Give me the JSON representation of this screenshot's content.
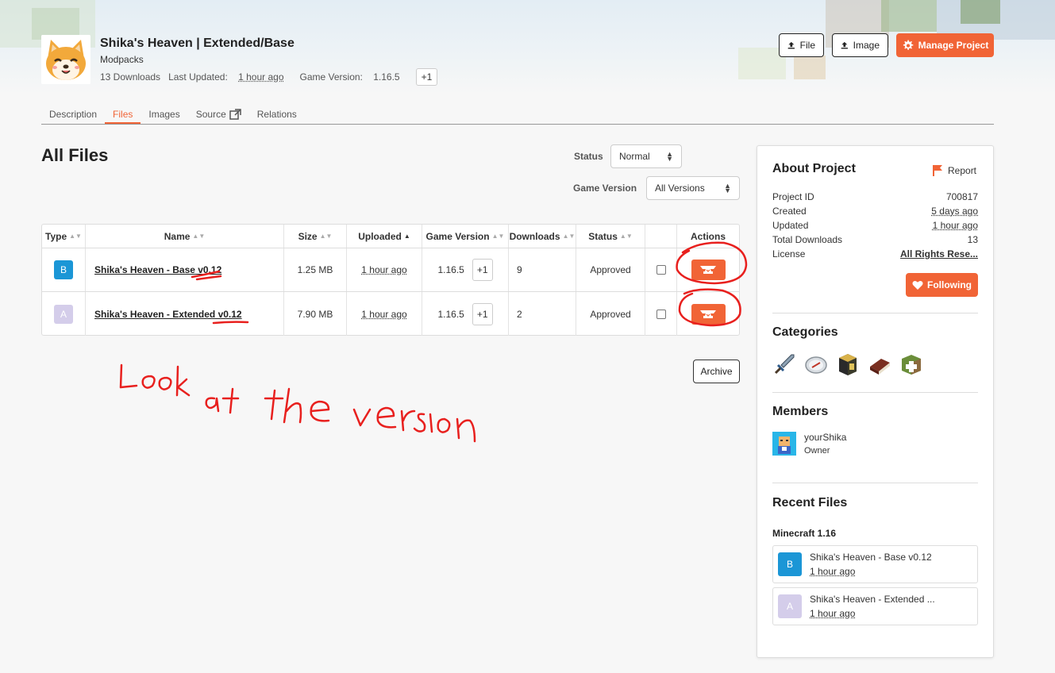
{
  "colors": {
    "accent": "#f16436",
    "type_b": "#1b96d6",
    "type_a": "#d4cdea",
    "annotation": "#e8201e"
  },
  "project": {
    "title": "Shika's Heaven | Extended/Base",
    "category": "Modpacks",
    "downloads": "13 Downloads",
    "last_updated_label": "Last Updated:",
    "last_updated_value": "1 hour ago",
    "game_version_label": "Game Version:",
    "game_version_value": "1.16.5",
    "extra_versions": "+1"
  },
  "header_buttons": {
    "file": "File",
    "image": "Image",
    "manage": "Manage Project"
  },
  "tabs": [
    {
      "label": "Description"
    },
    {
      "label": "Files",
      "active": true
    },
    {
      "label": "Images"
    },
    {
      "label": "Source"
    },
    {
      "label": "Relations"
    }
  ],
  "files": {
    "heading": "All Files",
    "status_label": "Status",
    "status_value": "Normal",
    "game_version_label": "Game Version",
    "game_version_value": "All Versions",
    "columns": [
      "Type",
      "Name",
      "Size",
      "Uploaded",
      "Game Version",
      "Downloads",
      "Status",
      "",
      "Actions"
    ],
    "rows": [
      {
        "type": "B",
        "name": "Shika's Heaven - Base v0.12",
        "size": "1.25 MB",
        "uploaded": "1 hour ago",
        "version": "1.16.5",
        "extra": "+1",
        "downloads": "9",
        "status": "Approved"
      },
      {
        "type": "A",
        "name": "Shika's Heaven - Extended v0.12",
        "size": "7.90 MB",
        "uploaded": "1 hour ago",
        "version": "1.16.5",
        "extra": "+1",
        "downloads": "2",
        "status": "Approved"
      }
    ],
    "archive_label": "Archive"
  },
  "annotation": {
    "text": "Look at the version"
  },
  "about": {
    "heading": "About Project",
    "report": "Report",
    "project_id_label": "Project ID",
    "project_id": "700817",
    "created_label": "Created",
    "created": "5 days ago",
    "updated_label": "Updated",
    "updated": "1 hour ago",
    "total_downloads_label": "Total Downloads",
    "total_downloads": "13",
    "license_label": "License",
    "license": "All Rights Rese...",
    "following": "Following"
  },
  "categories": {
    "heading": "Categories",
    "icons": [
      "sword-icon",
      "compass-icon",
      "block-icon",
      "book-icon",
      "plus-block-icon"
    ]
  },
  "members": {
    "heading": "Members",
    "name": "yourShika",
    "role": "Owner"
  },
  "recent": {
    "heading": "Recent Files",
    "group": "Minecraft 1.16",
    "items": [
      {
        "type": "B",
        "name": "Shika's Heaven - Base v0.12",
        "time": "1 hour ago"
      },
      {
        "type": "A",
        "name": "Shika's Heaven - Extended ...",
        "time": "1 hour ago"
      }
    ]
  }
}
